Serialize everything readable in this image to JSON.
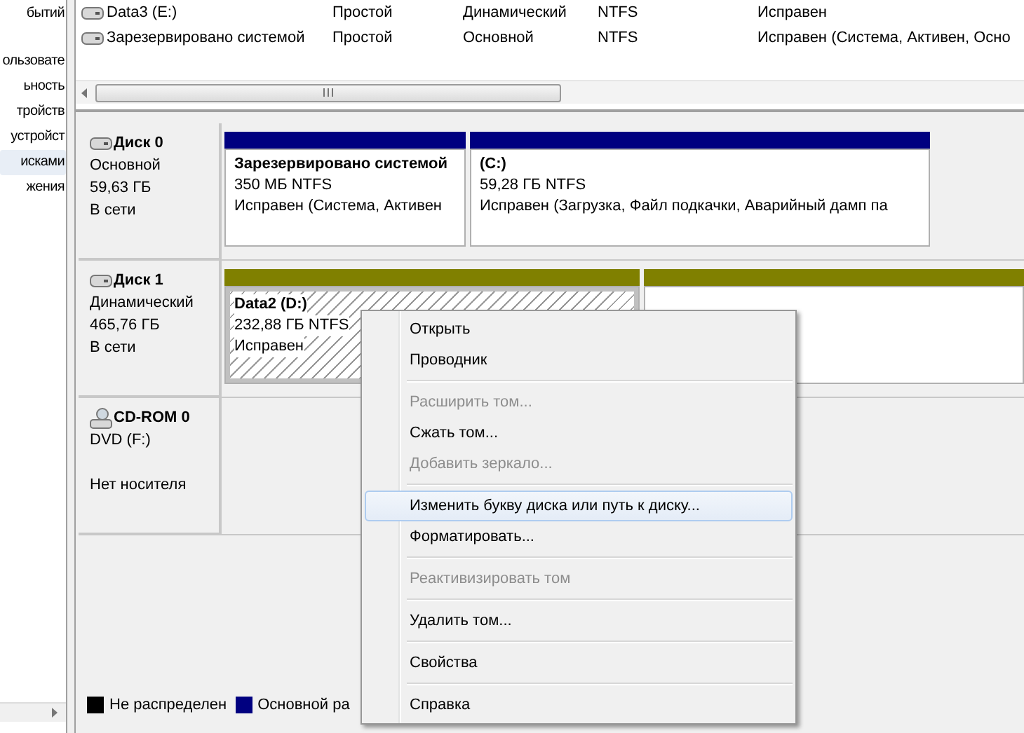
{
  "nav_items": [
    {
      "label": "бытий",
      "selected": false
    },
    {
      "label": "ользовате",
      "selected": false
    },
    {
      "label": "ьность",
      "selected": false
    },
    {
      "label": "тройств",
      "selected": false
    },
    {
      "label": "устройст",
      "selected": false
    },
    {
      "label": "исками",
      "selected": true
    },
    {
      "label": "жения",
      "selected": false
    }
  ],
  "volumes": [
    {
      "name": "Data3 (E:)",
      "layout": "Простой",
      "type": "Динамический",
      "fs": "NTFS",
      "status": "Исправен"
    },
    {
      "name": "Зарезервировано системой",
      "layout": "Простой",
      "type": "Основной",
      "fs": "NTFS",
      "status": "Исправен (Система, Активен, Осно"
    }
  ],
  "disks": [
    {
      "kind": "hdd",
      "name": "Диск 0",
      "type": "Основной",
      "size": "59,63 ГБ",
      "state": "В сети",
      "partitions": [
        {
          "name": "Зарезервировано системой",
          "size": "350 МБ NTFS",
          "status": "Исправен (Система, Активен",
          "color": "#000080",
          "selected": false
        },
        {
          "name": "(C:)",
          "size": "59,28 ГБ NTFS",
          "status": "Исправен (Загрузка, Файл подкачки, Аварийный дамп па",
          "color": "#000080",
          "selected": false
        }
      ]
    },
    {
      "kind": "hdd",
      "name": "Диск 1",
      "type": "Динамический",
      "size": "465,76 ГБ",
      "state": "В сети",
      "partitions": [
        {
          "name": "Data2  (D:)",
          "size": "232,88 ГБ NTFS",
          "status": "Исправен",
          "color": "#808000",
          "selected": true
        },
        {
          "color": "#808000",
          "selected": false
        }
      ]
    },
    {
      "kind": "cdrom",
      "name": "CD-ROM 0",
      "type": "DVD (F:)",
      "state": "Нет носителя"
    }
  ],
  "legend": [
    {
      "label": "Не распределен",
      "color": "#000000"
    },
    {
      "label": "Основной ра",
      "color": "#000080"
    }
  ],
  "context_menu": [
    {
      "kind": "item",
      "label": "Открыть",
      "disabled": false,
      "selected": false
    },
    {
      "kind": "item",
      "label": "Проводник",
      "disabled": false,
      "selected": false
    },
    {
      "kind": "separator"
    },
    {
      "kind": "item",
      "label": "Расширить том...",
      "disabled": true,
      "selected": false
    },
    {
      "kind": "item",
      "label": "Сжать том...",
      "disabled": false,
      "selected": false
    },
    {
      "kind": "item",
      "label": "Добавить зеркало...",
      "disabled": true,
      "selected": false
    },
    {
      "kind": "separator"
    },
    {
      "kind": "item",
      "label": "Изменить букву диска или путь к диску...",
      "disabled": false,
      "selected": true
    },
    {
      "kind": "item",
      "label": "Форматировать...",
      "disabled": false,
      "selected": false
    },
    {
      "kind": "separator"
    },
    {
      "kind": "item",
      "label": "Реактивизировать том",
      "disabled": true,
      "selected": false
    },
    {
      "kind": "separator"
    },
    {
      "kind": "item",
      "label": "Удалить том...",
      "disabled": false,
      "selected": false
    },
    {
      "kind": "separator"
    },
    {
      "kind": "item",
      "label": "Свойства",
      "disabled": false,
      "selected": false
    },
    {
      "kind": "separator"
    },
    {
      "kind": "item",
      "label": "Справка",
      "disabled": false,
      "selected": false
    }
  ]
}
